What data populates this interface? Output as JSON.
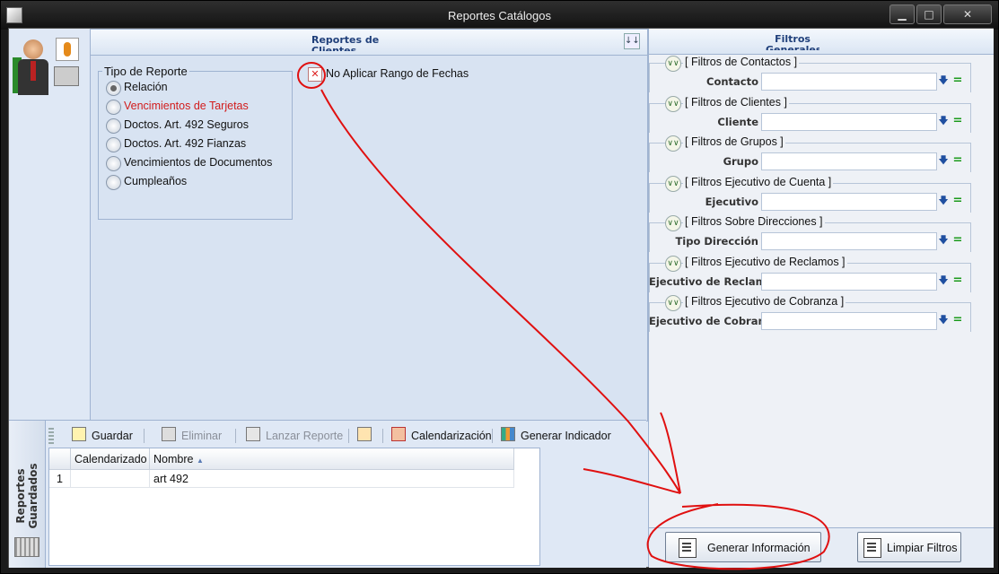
{
  "window": {
    "title": "Reportes Catálogos",
    "minimize": "▁",
    "maximize": "□",
    "close": "✕"
  },
  "left_panel": {
    "header": "Reportes de Clientes",
    "group_title": "Tipo de Reporte",
    "report_types": [
      {
        "label": "Relación",
        "selected": true,
        "highlight": false
      },
      {
        "label": "Vencimientos de Tarjetas",
        "selected": false,
        "highlight": true
      },
      {
        "label": "Doctos. Art. 492 Seguros",
        "selected": false,
        "highlight": false
      },
      {
        "label": "Doctos. Art. 492 Fianzas",
        "selected": false,
        "highlight": false
      },
      {
        "label": "Vencimientos de Documentos",
        "selected": false,
        "highlight": false
      },
      {
        "label": "Cumpleaños",
        "selected": false,
        "highlight": false
      }
    ],
    "date_range_checkbox": {
      "label": "No Aplicar Rango de Fechas",
      "checked": true,
      "mark": "✕"
    }
  },
  "right_panel": {
    "header": "Filtros Generales",
    "filters": [
      {
        "title": "[ Filtros de Contactos ]",
        "label": "Contacto",
        "value": ""
      },
      {
        "title": "[ Filtros de Clientes ]",
        "label": "Cliente",
        "value": ""
      },
      {
        "title": "[ Filtros de Grupos ]",
        "label": "Grupo",
        "value": ""
      },
      {
        "title": "[ Filtros Ejecutivo de Cuenta ]",
        "label": "Ejecutivo",
        "value": ""
      },
      {
        "title": "[ Filtros Sobre Direcciones ]",
        "label": "Tipo Dirección",
        "value": ""
      },
      {
        "title": "[ Filtros Ejecutivo de Reclamos ]",
        "label": "Ejecutivo de Reclamo",
        "value": ""
      },
      {
        "title": "[ Filtros Ejecutivo de Cobranza ]",
        "label": "Ejecutivo de Cobranza",
        "value": ""
      }
    ],
    "generate_button": "Generar Información",
    "clear_button": "Limpiar Filtros"
  },
  "saved_reports": {
    "tab_label": "Reportes Guardados",
    "toolbar": {
      "save": "Guardar",
      "delete": "Eliminar",
      "launch": "Lanzar Reporte",
      "schedule": "Calendarización",
      "indicator": "Generar Indicador"
    },
    "columns": [
      "Calendarizado",
      "Nombre"
    ],
    "sort_indicator": "▲",
    "rows": [
      {
        "num": "1",
        "calendarizado": "",
        "nombre": "art 492"
      }
    ]
  },
  "colors": {
    "accent": "#1f3f7a",
    "highlight_text": "#d21c1c",
    "annotation": "#e01010"
  }
}
